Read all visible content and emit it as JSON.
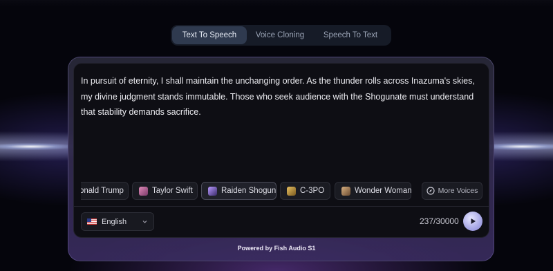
{
  "tabs": [
    {
      "label": "Text To Speech",
      "active": true
    },
    {
      "label": "Voice Cloning",
      "active": false
    },
    {
      "label": "Speech To Text",
      "active": false
    }
  ],
  "editor": {
    "text": "In pursuit of eternity, I shall maintain the unchanging order. As the thunder rolls across Inazuma's skies, my divine judgment stands immutable. Those who seek audience with the Shogunate must understand that stability demands sacrifice."
  },
  "voices": [
    {
      "label": "onald Trump",
      "icon": "none"
    },
    {
      "label": "Taylor Swift",
      "icon": "taylor-swift-avatar-icon",
      "color": "#c86aa0"
    },
    {
      "label": "Raiden Shogun",
      "icon": "raiden-shogun-avatar-icon",
      "color": "#7a5ac8",
      "selected": true
    },
    {
      "label": "C-3PO",
      "icon": "c3po-avatar-icon",
      "color": "#c89a40"
    },
    {
      "label": "Wonder Woman",
      "icon": "wonder-woman-avatar-icon",
      "color": "#b08a60"
    }
  ],
  "more_voices": {
    "label": "More Voices",
    "icon": "compass-icon"
  },
  "language": {
    "label": "English",
    "flag": "us-flag-icon"
  },
  "counter": "237/30000",
  "play": {
    "icon": "play-icon",
    "color": "#a8a8e6"
  },
  "footer": "Powered by Fish Audio S1",
  "colors": {
    "background": "#05050c",
    "card": "#0e0e14",
    "active_tab": "#2f3a4f"
  }
}
